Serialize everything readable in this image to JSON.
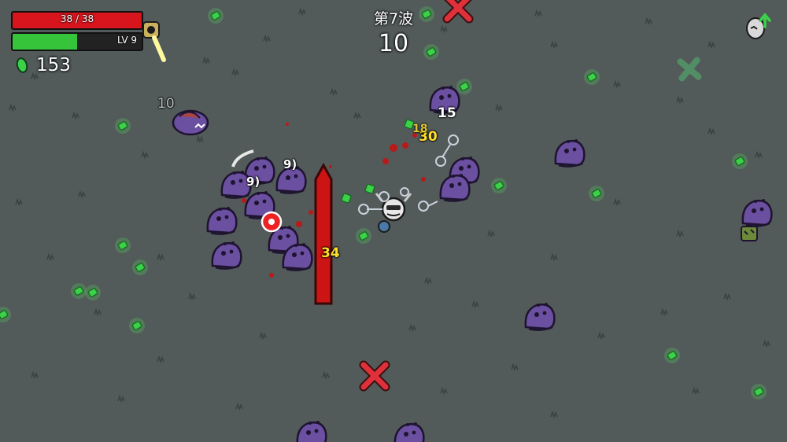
{
  "hud": {
    "hp_text": "38 / 38",
    "hp_fraction": 1.0,
    "level_text": "LV 9",
    "xp_fraction": 0.5,
    "materials_count": "153",
    "wave_label": "第7波",
    "wave_timer": "10"
  },
  "damage_numbers": [
    {
      "text": "15",
      "style": "white"
    },
    {
      "text": "30",
      "style": "yellow"
    },
    {
      "text": "18",
      "style": "yellow"
    },
    {
      "text": "34",
      "style": "yellow"
    },
    {
      "text": "9)",
      "style": "white"
    },
    {
      "text": "9)",
      "style": "white"
    },
    {
      "text": "10",
      "style": "grey"
    }
  ],
  "colors": {
    "ground": "#525a5a",
    "enemy": "#6b4fa0",
    "material": "#3bd24a",
    "hp": "#d8141c",
    "xp": "#35c43a",
    "spawn_marker": "#e0303a",
    "heal_marker": "#52a46a"
  },
  "icons": [
    "material-icon",
    "level-up-egg-icon",
    "player-character",
    "enemy-alien",
    "spawn-marker-icon",
    "turret-icon"
  ]
}
